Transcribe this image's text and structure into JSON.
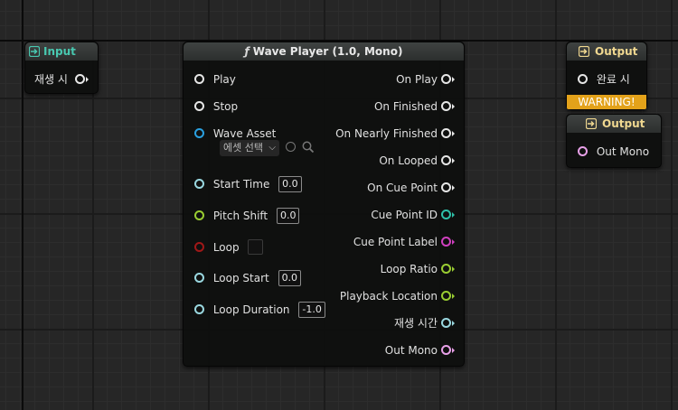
{
  "input_node": {
    "title": "Input",
    "pin_label": "재생 시"
  },
  "wave_player": {
    "title": "Wave Player (1.0, Mono)",
    "func_symbol": "ƒ",
    "inputs": {
      "play": "Play",
      "stop": "Stop",
      "wave_asset": "Wave Asset",
      "wave_asset_dropdown": "에셋 선택",
      "start_time": "Start Time",
      "start_time_value": "0.0",
      "pitch_shift": "Pitch Shift",
      "pitch_shift_value": "0.0",
      "loop": "Loop",
      "loop_start": "Loop Start",
      "loop_start_value": "0.0",
      "loop_duration": "Loop Duration",
      "loop_duration_value": "-1.0"
    },
    "outputs": {
      "on_play": "On Play",
      "on_finished": "On Finished",
      "on_nearly_finished": "On Nearly Finished",
      "on_looped": "On Looped",
      "on_cue_point": "On Cue Point",
      "cue_point_id": "Cue Point ID",
      "cue_point_label": "Cue Point Label",
      "loop_ratio": "Loop Ratio",
      "playback_location": "Playback Location",
      "playback_time": "재생 시간",
      "out_mono": "Out Mono"
    }
  },
  "output_node_1": {
    "title": "Output",
    "pin_label": "완료 시",
    "warning": "WARNING!"
  },
  "output_node_2": {
    "title": "Output",
    "pin_label": "Out Mono"
  },
  "colors": {
    "exec_pin": "#e8e8e8",
    "float_pin": "#8fd8e8",
    "time_pin": "#9ad8e0",
    "int_pin": "#2ec0a8",
    "string_pin": "#d040c0",
    "bool_pin": "#a01818",
    "ratio_pin": "#9acd32",
    "audio_pin": "#e8a0e8",
    "wave_pin": "#2aa0e0",
    "warning_bg": "#e3a21a"
  }
}
